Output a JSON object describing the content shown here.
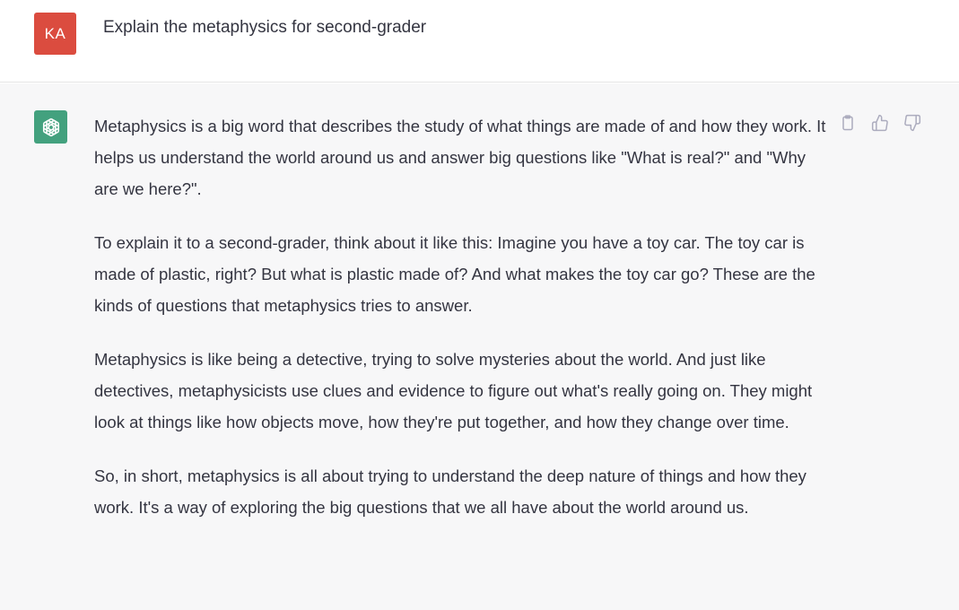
{
  "user_message": {
    "avatar_initials": "KA",
    "avatar_color": "#db4c3f",
    "text": "Explain the metaphysics for second-grader"
  },
  "assistant_message": {
    "avatar_icon": "openai-logo-icon",
    "avatar_color": "#43a17e",
    "paragraphs": [
      "Metaphysics is a big word that describes the study of what things are made of and how they work. It helps us understand the world around us and answer big questions like \"What is real?\" and \"Why are we here?\".",
      "To explain it to a second-grader, think about it like this: Imagine you have a toy car. The toy car is made of plastic, right? But what is plastic made of? And what makes the toy car go? These are the kinds of questions that metaphysics tries to answer.",
      "Metaphysics is like being a detective, trying to solve mysteries about the world. And just like detectives, metaphysicists use clues and evidence to figure out what's really going on. They might look at things like how objects move, how they're put together, and how they change over time.",
      "So, in short, metaphysics is all about trying to understand the deep nature of things and how they work. It's a way of exploring the big questions that we all have about the world around us."
    ]
  },
  "actions": {
    "copy_icon": "clipboard-icon",
    "like_icon": "thumbs-up-icon",
    "dislike_icon": "thumbs-down-icon"
  }
}
